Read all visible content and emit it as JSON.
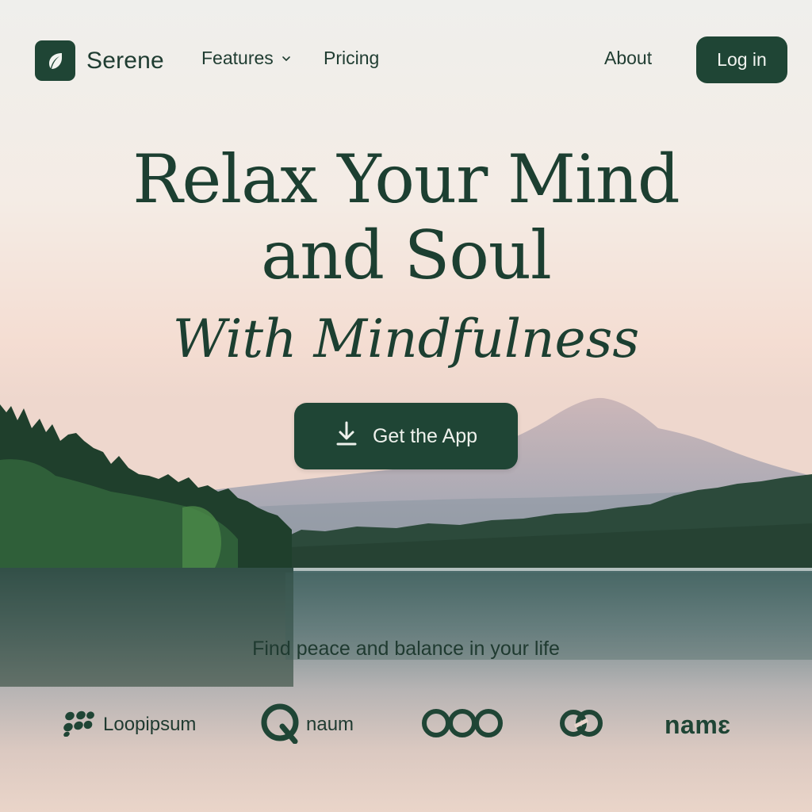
{
  "nav": {
    "brand": "Serene",
    "links": [
      {
        "label": "Features",
        "has_dropdown": true
      },
      {
        "label": "Pricing"
      },
      {
        "label": "About"
      }
    ],
    "login_label": "Log in"
  },
  "hero": {
    "title_line1": "Relax Your Mind",
    "title_line2": "and Soul",
    "subtitle": "With Mindfulness",
    "cta_label": "Get the App",
    "tagline": "Find peace and balance in your life"
  },
  "logos": [
    {
      "name": "Loopipsum",
      "icon": "dots-cluster-icon"
    },
    {
      "name": "naum",
      "icon": "q-letter-icon"
    },
    {
      "name": "",
      "icon": "infinity-icon"
    },
    {
      "name": "",
      "icon": "chain-link-icon"
    },
    {
      "name": "namɛ",
      "icon": ""
    }
  ],
  "colors": {
    "primary": "#1f4535",
    "text": "#1c3f31",
    "button_text": "#f2f4f0"
  }
}
